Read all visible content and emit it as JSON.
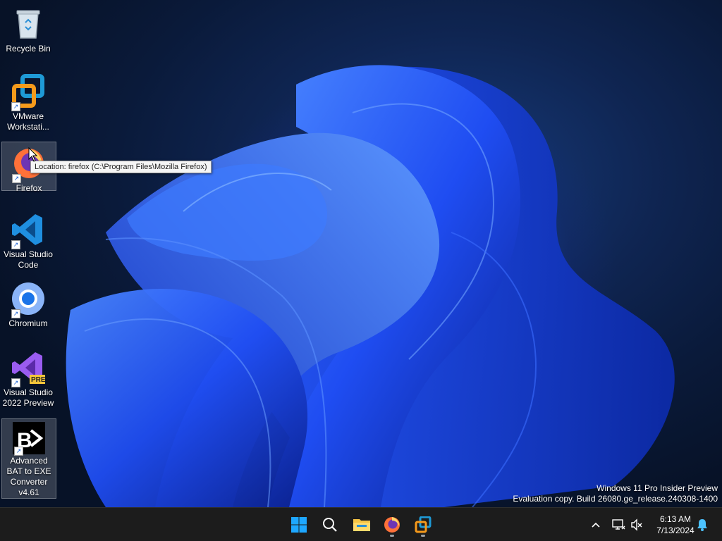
{
  "desktop": {
    "icons": [
      {
        "label": "Recycle Bin"
      },
      {
        "label": "VMware\nWorkstati..."
      },
      {
        "label": "Firefox"
      },
      {
        "label": "Visual Studio\nCode"
      },
      {
        "label": "Chromium"
      },
      {
        "label": "Visual Studio\n2022 Preview"
      },
      {
        "label": "Advanced\nBAT to EXE\nConverter\nv4.61"
      }
    ],
    "tooltip": "Location: firefox (C:\\Program Files\\Mozilla Firefox)",
    "watermark": {
      "line1": "Windows 11 Pro Insider Preview",
      "line2": "Evaluation copy. Build 26080.ge_release.240308-1400"
    },
    "badge_pre": "PRE"
  },
  "taskbar": {
    "pinned": [
      "start-icon",
      "search-icon",
      "file-explorer-icon",
      "firefox-icon",
      "vmware-icon"
    ],
    "clock": {
      "time": "6:13 AM",
      "date": "7/13/2024"
    }
  },
  "colors": {
    "taskbar_bg": "#1c1c1c",
    "wallpaper_blue": "#1e4fff",
    "accent": "#0078d4"
  }
}
